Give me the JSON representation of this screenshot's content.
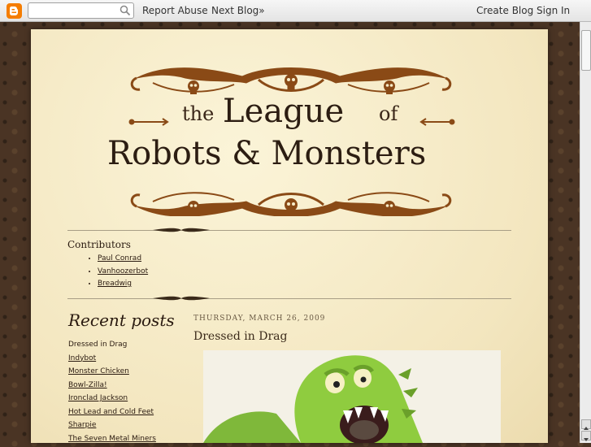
{
  "navbar": {
    "search": {
      "value": "",
      "placeholder": ""
    },
    "report_abuse": "Report Abuse",
    "next_blog": "Next Blog»",
    "create_blog": "Create Blog",
    "sign_in": "Sign In"
  },
  "header": {
    "the": "the",
    "league": "League",
    "of": "of",
    "main": "Robots & Monsters"
  },
  "contributors": {
    "title": "Contributors",
    "items": [
      "Paul Conrad",
      "Vanhoozerbot",
      "Breadwig"
    ]
  },
  "recent_posts": {
    "title": "Recent posts",
    "items": [
      "Dressed in Drag",
      "Indybot",
      "Monster Chicken",
      "Bowl-Zilla!",
      "Ironclad Jackson",
      "Hot Lead and Cold Feet",
      "Sharpie",
      "The Seven Metal Miners"
    ]
  },
  "post": {
    "date": "THURSDAY, MARCH 26, 2009",
    "title": "Dressed in Drag"
  },
  "colors": {
    "ornament": "#8a4a16",
    "page": "#f6ecc9",
    "blogger": "#f57d00"
  }
}
